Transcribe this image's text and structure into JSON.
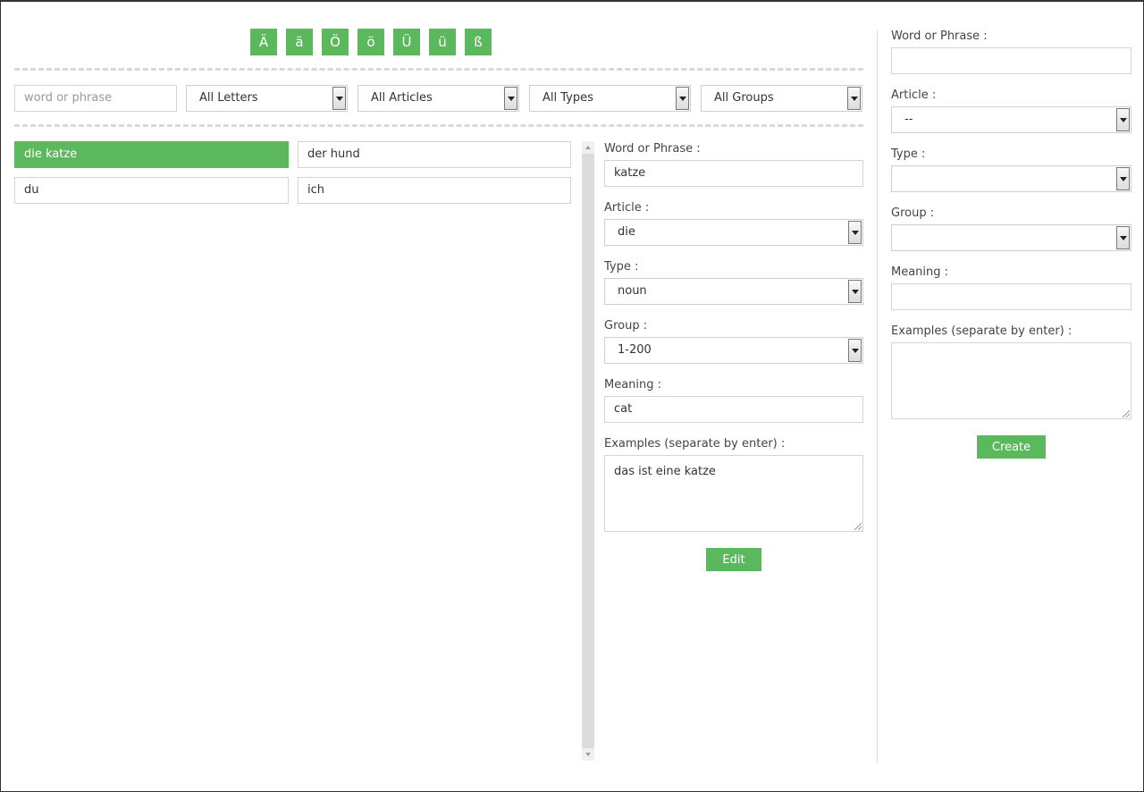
{
  "letters": [
    "Ä",
    "ä",
    "Ö",
    "ö",
    "Ü",
    "ü",
    "ß"
  ],
  "filters": {
    "search_placeholder": "word or phrase",
    "letters": "All Letters",
    "articles": "All Articles",
    "types": "All Types",
    "groups": "All Groups"
  },
  "words": [
    "die katze",
    "der hund",
    "du",
    "ich"
  ],
  "edit_form": {
    "word_label": "Word or Phrase :",
    "word_value": "katze",
    "article_label": "Article :",
    "article_value": "die",
    "type_label": "Type :",
    "type_value": "noun",
    "group_label": "Group :",
    "group_value": "1-200",
    "meaning_label": "Meaning :",
    "meaning_value": "cat",
    "examples_label": "Examples (separate by enter) :",
    "examples_value": "das ist eine katze",
    "button": "Edit"
  },
  "create_form": {
    "word_label": "Word or Phrase :",
    "word_value": "",
    "article_label": "Article :",
    "article_value": "--",
    "type_label": "Type :",
    "type_value": "",
    "group_label": "Group :",
    "group_value": "",
    "meaning_label": "Meaning :",
    "meaning_value": "",
    "examples_label": "Examples (separate by enter) :",
    "examples_value": "",
    "button": "Create"
  },
  "colors": {
    "accent": "#5cb85c",
    "border": "#d4d4d4"
  }
}
